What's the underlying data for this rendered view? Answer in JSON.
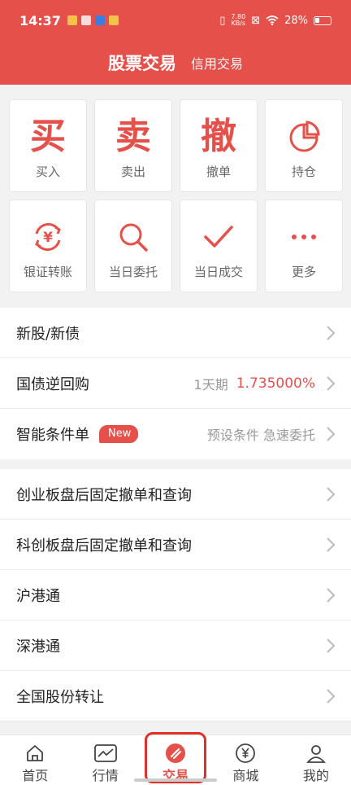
{
  "status_bar": {
    "time": "14:37",
    "speed": "7.80",
    "speed_unit": "KB/s",
    "battery": "28%"
  },
  "header": {
    "title": "股票交易",
    "subtitle": "信用交易"
  },
  "tiles_row1": [
    {
      "glyph": "买",
      "label": "买入"
    },
    {
      "glyph": "卖",
      "label": "卖出"
    },
    {
      "glyph": "撤",
      "label": "撤单"
    },
    {
      "icon": "pie-chart-icon",
      "label": "持仓"
    }
  ],
  "tiles_row2": [
    {
      "icon": "yuan-transfer-icon",
      "glyph": "¥",
      "label": "银证转账"
    },
    {
      "icon": "search-icon",
      "label": "当日委托"
    },
    {
      "icon": "checkmark-icon",
      "label": "当日成交"
    },
    {
      "icon": "more-icon",
      "label": "更多"
    }
  ],
  "list_group1": [
    {
      "title": "新股/新债"
    },
    {
      "title": "国债逆回购",
      "period": "1天期",
      "rate": "1.735000%"
    },
    {
      "title": "智能条件单",
      "badge": "New",
      "hint": "预设条件 急速委托"
    }
  ],
  "list_group2": [
    {
      "title": "创业板盘后固定撤单和查询"
    },
    {
      "title": "科创板盘后固定撤单和查询"
    },
    {
      "title": "沪港通"
    },
    {
      "title": "深港通"
    },
    {
      "title": "全国股份转让"
    }
  ],
  "tabbar": [
    {
      "label": "首页",
      "icon": "home-icon"
    },
    {
      "label": "行情",
      "icon": "chart-icon"
    },
    {
      "label": "交易",
      "icon": "trade-icon",
      "active": true
    },
    {
      "label": "商城",
      "icon": "yuan-icon"
    },
    {
      "label": "我的",
      "icon": "user-icon"
    }
  ],
  "colors": {
    "brand": "#e5514a",
    "text": "#222222",
    "muted": "#999999"
  }
}
